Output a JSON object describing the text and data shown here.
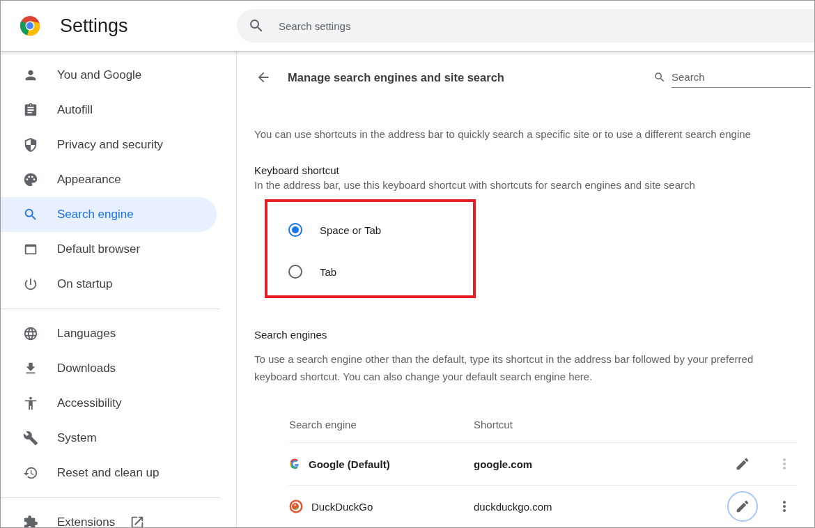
{
  "header": {
    "title": "Settings",
    "search": {
      "placeholder": "Search settings"
    }
  },
  "sidebar": {
    "items": [
      {
        "label": "You and Google",
        "selected": false
      },
      {
        "label": "Autofill",
        "selected": false
      },
      {
        "label": "Privacy and security",
        "selected": false
      },
      {
        "label": "Appearance",
        "selected": false
      },
      {
        "label": "Search engine",
        "selected": true
      },
      {
        "label": "Default browser",
        "selected": false
      },
      {
        "label": "On startup",
        "selected": false
      },
      {
        "label": "Languages",
        "selected": false
      },
      {
        "label": "Downloads",
        "selected": false
      },
      {
        "label": "Accessibility",
        "selected": false
      },
      {
        "label": "System",
        "selected": false
      },
      {
        "label": "Reset and clean up",
        "selected": false
      },
      {
        "label": "Extensions",
        "selected": false
      }
    ]
  },
  "page": {
    "title": "Manage search engines and site search",
    "search": {
      "placeholder": "Search"
    },
    "intro": "You can use shortcuts in the address bar to quickly search a specific site or to use a different search engine",
    "keyboard_shortcut": {
      "title": "Keyboard shortcut",
      "description": "In the address bar, use this keyboard shortcut with shortcuts for search engines and site search",
      "highlighted": true,
      "options": [
        {
          "label": "Space or Tab",
          "selected": true
        },
        {
          "label": "Tab",
          "selected": false
        }
      ]
    },
    "search_engines": {
      "title": "Search engines",
      "description": "To use a search engine other than the default, type its shortcut in the address bar followed by your preferred keyboard shortcut. You can also change your default search engine here.",
      "columns": [
        "Search engine",
        "Shortcut"
      ],
      "rows": [
        {
          "name": "Google (Default)",
          "shortcut": "google.com",
          "is_default": true,
          "focused": false
        },
        {
          "name": "DuckDuckGo",
          "shortcut": "duckduckgo.com",
          "is_default": false,
          "focused": true
        }
      ]
    }
  }
}
